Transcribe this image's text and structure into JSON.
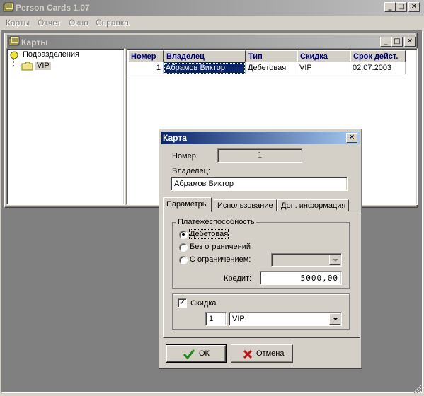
{
  "app": {
    "title": "Person Cards 1.07"
  },
  "menu": [
    "Карты",
    "Отчет",
    "Окно",
    "Справка"
  ],
  "child": {
    "title": "Карты",
    "tree": {
      "root": "Подразделения",
      "child": "VIP"
    },
    "grid": {
      "columns": [
        "Номер",
        "Владелец",
        "Тип",
        "Скидка",
        "Срок дейст."
      ],
      "rows": [
        [
          "1",
          "Абрамов Виктор",
          "Дебетовая",
          "VIP",
          "02.07.2003"
        ]
      ]
    }
  },
  "dialog": {
    "title": "Карта",
    "number_label": "Номер:",
    "number_value": "1",
    "owner_label": "Владелец:",
    "owner_value": "Абрамов Виктор",
    "tabs": [
      "Параметры",
      "Использование",
      "Доп. информация"
    ],
    "solvency": {
      "title": "Платежеспособность",
      "options": [
        "Дебетовая",
        "Без ограничений",
        "С ограничением:"
      ],
      "selected": 0
    },
    "credit_label": "Кредит:",
    "credit_value": "5000,00",
    "discount": {
      "label": "Скидка",
      "checked": true,
      "number": "1",
      "name": "VIP"
    },
    "ok_label": "ОК",
    "cancel_label": "Отмена"
  },
  "colors": {
    "active_title": "#0a246a",
    "inactive_title": "#808080",
    "face": "#d4d0c8",
    "header_text": "#000080",
    "selection": "#0a246a"
  },
  "icons": [
    "cards-app-icon",
    "minimize-icon",
    "maximize-icon",
    "close-icon",
    "folder-icon",
    "tree-node-icon",
    "checkmark-icon",
    "cross-icon",
    "chevron-down-icon"
  ]
}
